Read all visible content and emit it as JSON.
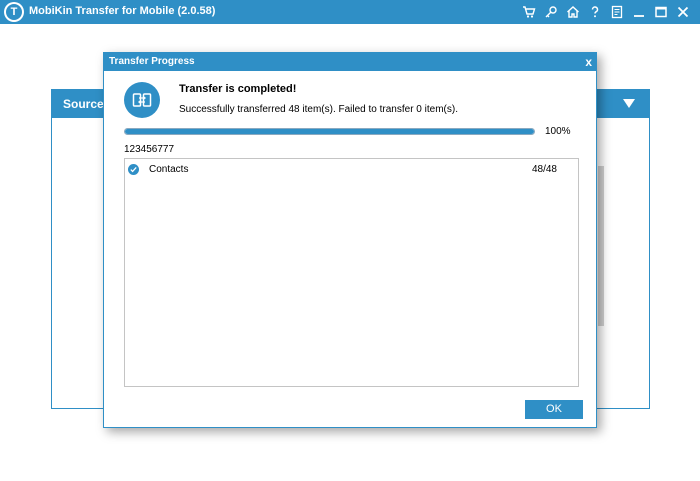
{
  "app": {
    "title": "MobiKin Transfer for Mobile  (2.0.58)",
    "logo_letter": "T",
    "toolbar_icons": [
      "cart-icon",
      "key-icon",
      "home-icon",
      "help-icon",
      "feedback-icon",
      "minimize-icon",
      "maximize-icon",
      "close-icon"
    ]
  },
  "background_panel": {
    "source_label": "Source:"
  },
  "dialog": {
    "title": "Transfer Progress",
    "close_label": "x",
    "heading": "Transfer is completed!",
    "detail": "Successfully transferred 48 item(s). Failed to transfer 0 item(s).",
    "progress_fraction": 1.0,
    "progress_label": "100%",
    "device_name": "123456777",
    "items": [
      {
        "label": "Contacts",
        "count": "48/48",
        "checked": true
      }
    ],
    "ok_label": "OK"
  },
  "colors": {
    "accent": "#2f8fc6"
  }
}
